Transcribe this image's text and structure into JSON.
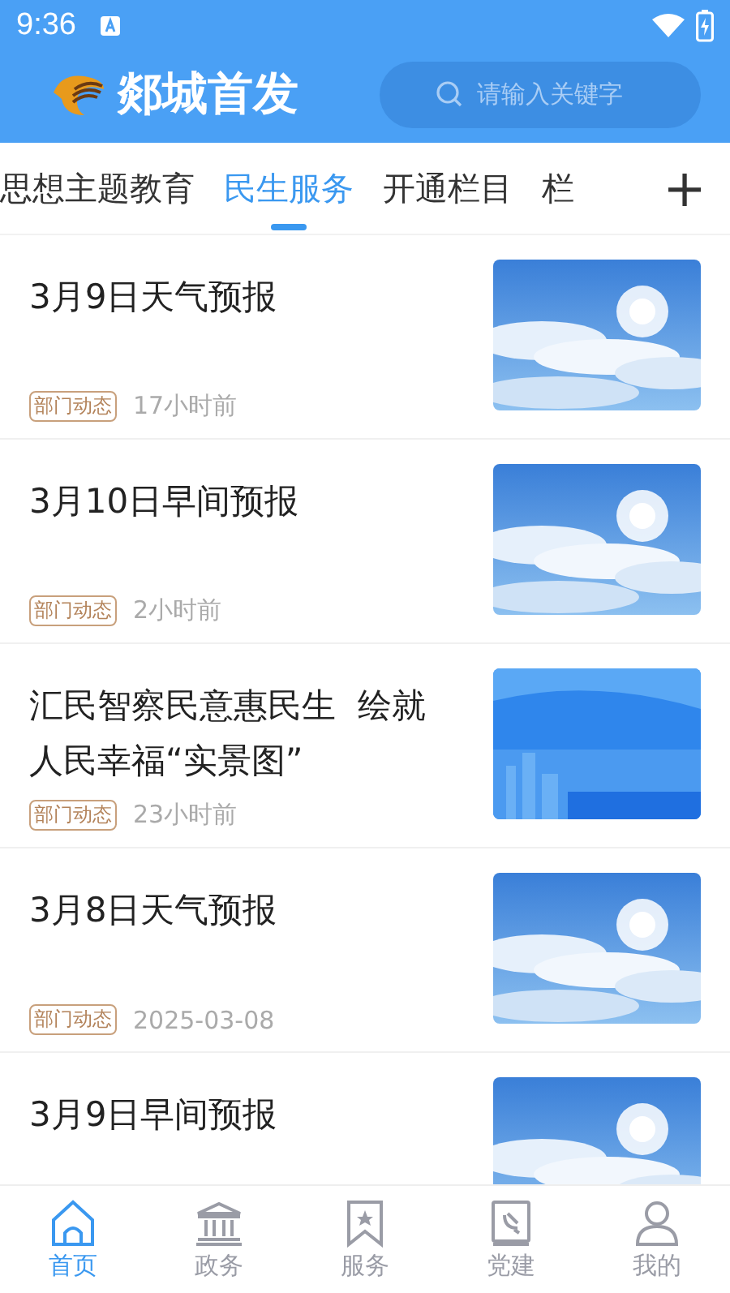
{
  "status_bar": {
    "time": "9:36"
  },
  "header": {
    "app_name": "郯城首发",
    "search": {
      "placeholder": "请输入关键字"
    }
  },
  "tabs": [
    {
      "label": "思想主题教育",
      "selected": false
    },
    {
      "label": "民生服务",
      "selected": true
    },
    {
      "label": "开通栏目",
      "selected": false
    },
    {
      "label": "栏",
      "selected": false
    }
  ],
  "add_tab": "+",
  "articles": [
    {
      "title": "3月9日天气预报",
      "tag": "部门动态",
      "time": "17小时前"
    },
    {
      "title": "3月10日早间预报",
      "tag": "部门动态",
      "time": "2小时前"
    },
    {
      "title": "汇民智察民意惠民生  绘就人民幸福“实景图”",
      "tag": "部门动态",
      "time": "23小时前"
    },
    {
      "title": "3月8日天气预报",
      "tag": "部门动态",
      "time": "2025-03-08"
    },
    {
      "title": "3月9日早间预报"
    }
  ],
  "bottom_nav": [
    {
      "label": "首页",
      "selected": true
    },
    {
      "label": "政务",
      "selected": false
    },
    {
      "label": "服务",
      "selected": false
    },
    {
      "label": "党建",
      "selected": false
    },
    {
      "label": "我的",
      "selected": false
    }
  ]
}
